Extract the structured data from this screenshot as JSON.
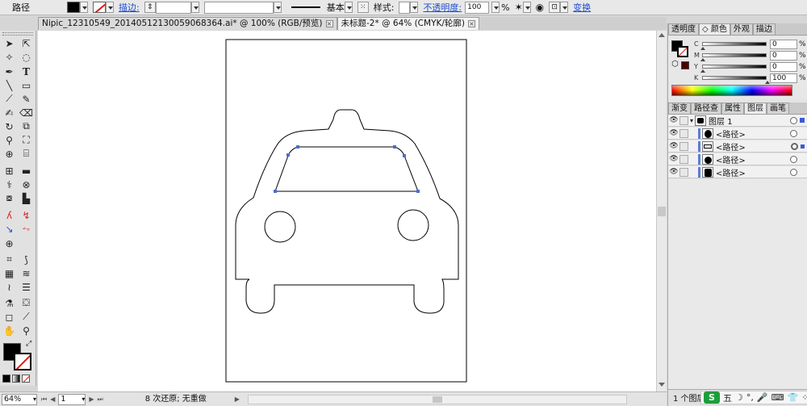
{
  "control_bar": {
    "object_label": "路径",
    "stroke_label": "描边:",
    "stroke_profile": "基本",
    "style_label": "样式:",
    "opacity_label": "不透明度:",
    "opacity_value": "100",
    "opacity_unit": "%",
    "transform_label": "变换"
  },
  "tabs": [
    {
      "label": "Nipic_12310549_20140512130059068364.ai* @ 100% (RGB/预览)",
      "active": false
    },
    {
      "label": "未标题-2* @ 64% (CMYK/轮廓)",
      "active": true
    }
  ],
  "status": {
    "zoom": "64%",
    "artboard": "1",
    "undo_text": "8 次还原; 无重做"
  },
  "color_panel": {
    "tabs": [
      "透明度",
      "颜色",
      "外观",
      "描边"
    ],
    "active_tab": "颜色",
    "channels": [
      {
        "name": "C",
        "value": "0",
        "unit": "%"
      },
      {
        "name": "M",
        "value": "0",
        "unit": "%"
      },
      {
        "name": "Y",
        "value": "0",
        "unit": "%"
      },
      {
        "name": "K",
        "value": "100",
        "unit": "%"
      }
    ]
  },
  "layers_panel": {
    "tabs": [
      "渐变",
      "路径查",
      "属性",
      "图层",
      "画笔"
    ],
    "active_tab": "图层",
    "rows": [
      {
        "name": "图层 1",
        "icon": "expand-arrow-icon"
      },
      {
        "name": "<路径>"
      },
      {
        "name": "<路径>"
      },
      {
        "name": "<路径>"
      },
      {
        "name": "<路径>"
      }
    ],
    "footer": "1 个图层"
  },
  "ime": {
    "logo": "S",
    "mode": "五"
  },
  "colors": {
    "accent": "#3b5ad8",
    "selection_path": "#4a6ed0",
    "ime_green": "#1d9e3a"
  }
}
